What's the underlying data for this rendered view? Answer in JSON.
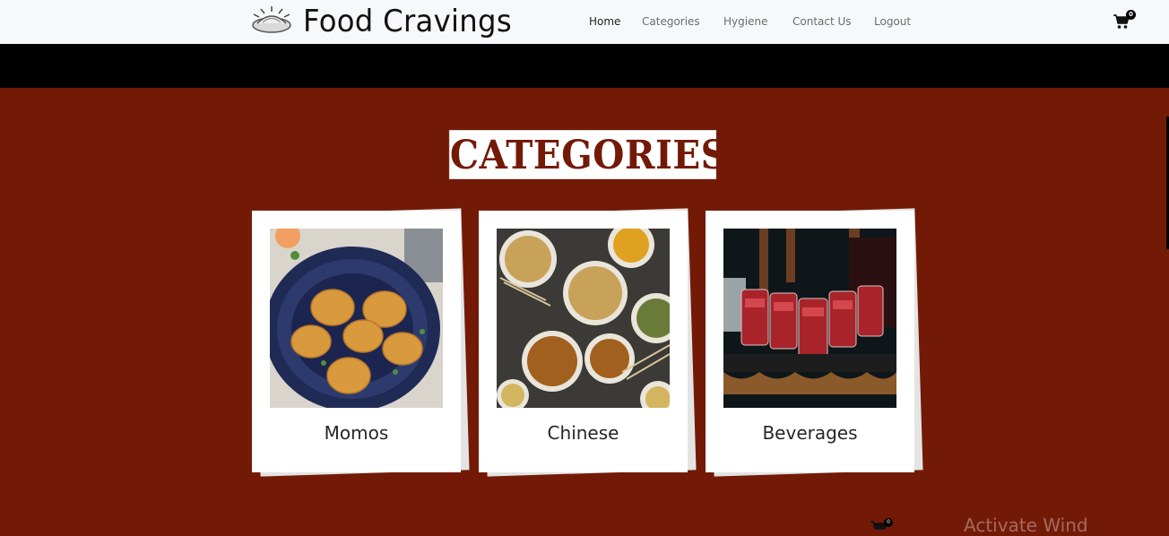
{
  "header": {
    "brand": "Food Cravings",
    "nav": [
      {
        "label": "Home",
        "active": true
      },
      {
        "label": "Categories",
        "active": false
      },
      {
        "label": "Hygiene",
        "active": false
      },
      {
        "label": "Contact Us",
        "active": false
      },
      {
        "label": "Logout",
        "active": false
      }
    ],
    "cart_count": "0"
  },
  "section": {
    "title": "CATEGORIES",
    "categories": [
      {
        "label": "Momos"
      },
      {
        "label": "Chinese"
      },
      {
        "label": "Beverages"
      }
    ]
  },
  "footer_peek": {
    "cart_count": "0",
    "watermark": "Activate Wind"
  },
  "colors": {
    "background": "#731a07",
    "navbar": "#f7f8fa",
    "title_text": "#731a07"
  },
  "icons": [
    "dumpling-logo-icon",
    "cart-icon"
  ]
}
